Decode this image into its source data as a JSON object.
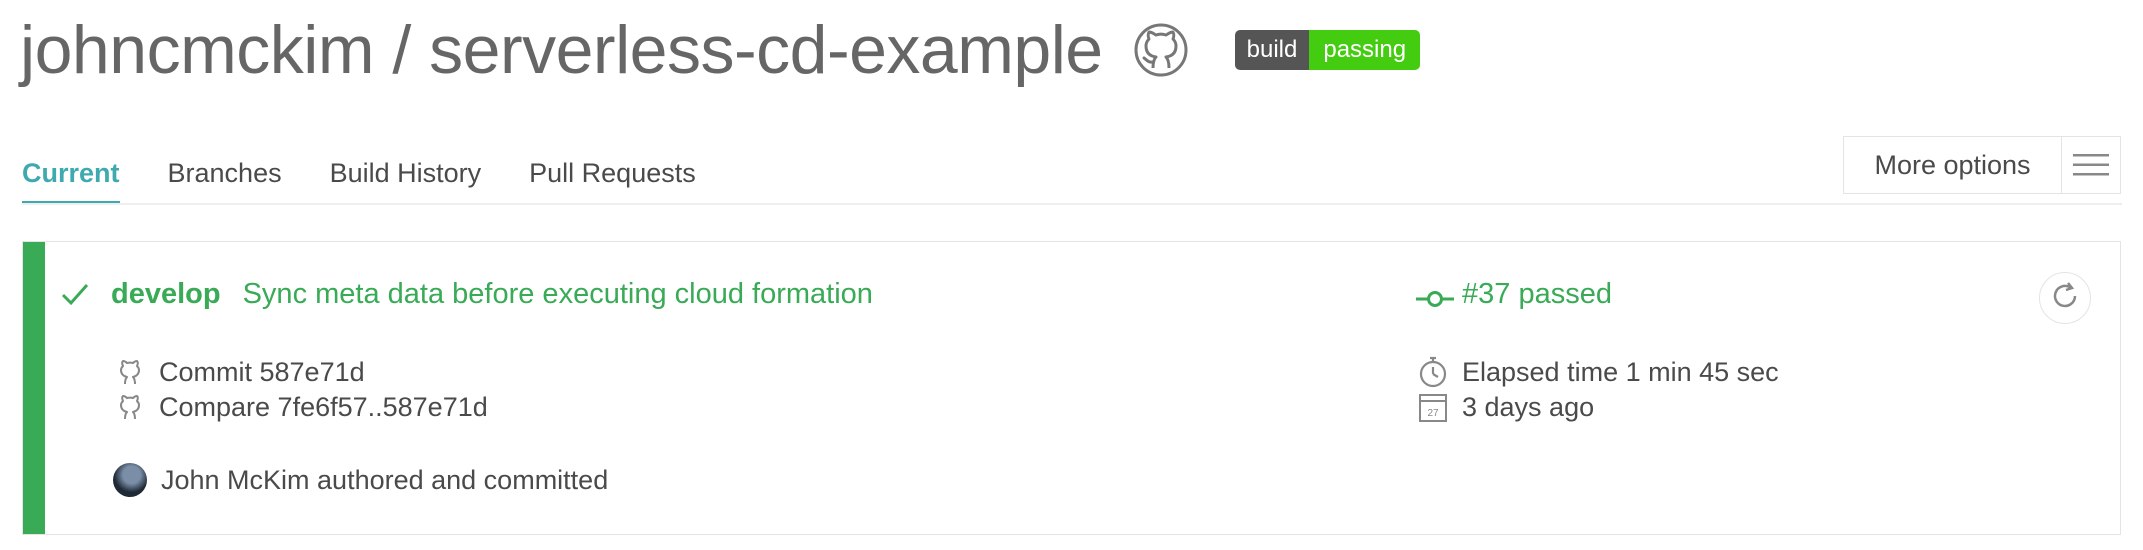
{
  "header": {
    "repo_title": "johncmckim / serverless-cd-example",
    "badge": {
      "label": "build",
      "status": "passing",
      "label_color": "#555555",
      "status_color": "#44cc11"
    }
  },
  "tabs": [
    {
      "label": "Current",
      "active": true
    },
    {
      "label": "Branches",
      "active": false
    },
    {
      "label": "Build History",
      "active": false
    },
    {
      "label": "Pull Requests",
      "active": false
    }
  ],
  "more_options": {
    "label": "More options",
    "icon": "hamburger-menu-icon"
  },
  "build": {
    "status_color": "#39aa56",
    "branch": "develop",
    "message": "Sync meta data before executing cloud formation",
    "number_status": "#37 passed",
    "commit": "Commit 587e71d",
    "compare": "Compare 7fe6f57..587e71d",
    "elapsed": "Elapsed time 1 min 45 sec",
    "when": "3 days ago",
    "calendar_day": "27",
    "author": "John McKim authored and committed"
  },
  "colors": {
    "accent": "#3eaaaf",
    "success": "#39aa56",
    "text": "#4a4a4a"
  }
}
